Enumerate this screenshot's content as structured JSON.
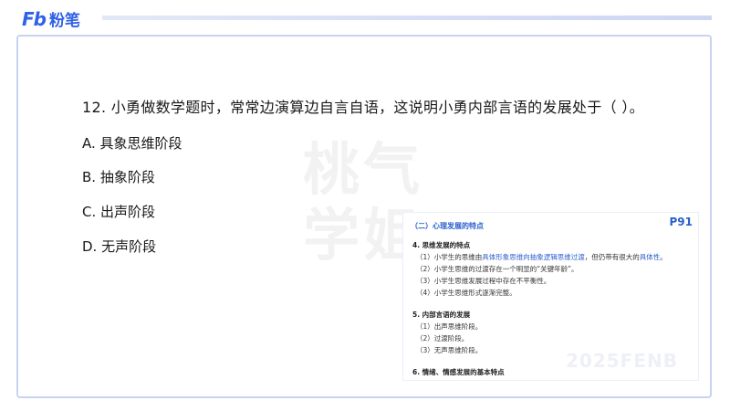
{
  "brand": {
    "mark": "Fb",
    "name": "粉笔"
  },
  "watermark": {
    "line1": "桃气",
    "line2": "学姐"
  },
  "question": {
    "stem": "12. 小勇做数学题时，常常边演算边自言自语，这说明小勇内部言语的发展处于（ ）。",
    "options": [
      "A. 具象思维阶段",
      "B. 抽象阶段",
      "C. 出声阶段",
      "D. 无声阶段"
    ]
  },
  "note": {
    "page": "P91",
    "section": "（二）心理发展的特点",
    "h4": "4. 思维发展的特点",
    "l1_pre": "（1）小学生的思维由",
    "l1_hl": "具体形象思维向抽象逻辑思维过渡",
    "l1_mid": "，但仍带有很大的",
    "l1_hl2": "具体性",
    "l1_end": "。",
    "l2": "（2）小学生思维的过渡存在一个明显的“关键年龄”。",
    "l3": "（3）小学生思维发展过程中存在不平衡性。",
    "l4": "（4）小学生思维形式逐渐完整。",
    "h5": "5. 内部言语的发展",
    "m1": "（1）出声思维阶段。",
    "m2": "（2）过渡阶段。",
    "m3": "（3）无声思维阶段。",
    "h6": "6. 情绪、情感发展的基本特点",
    "wm": "2025FENB"
  }
}
